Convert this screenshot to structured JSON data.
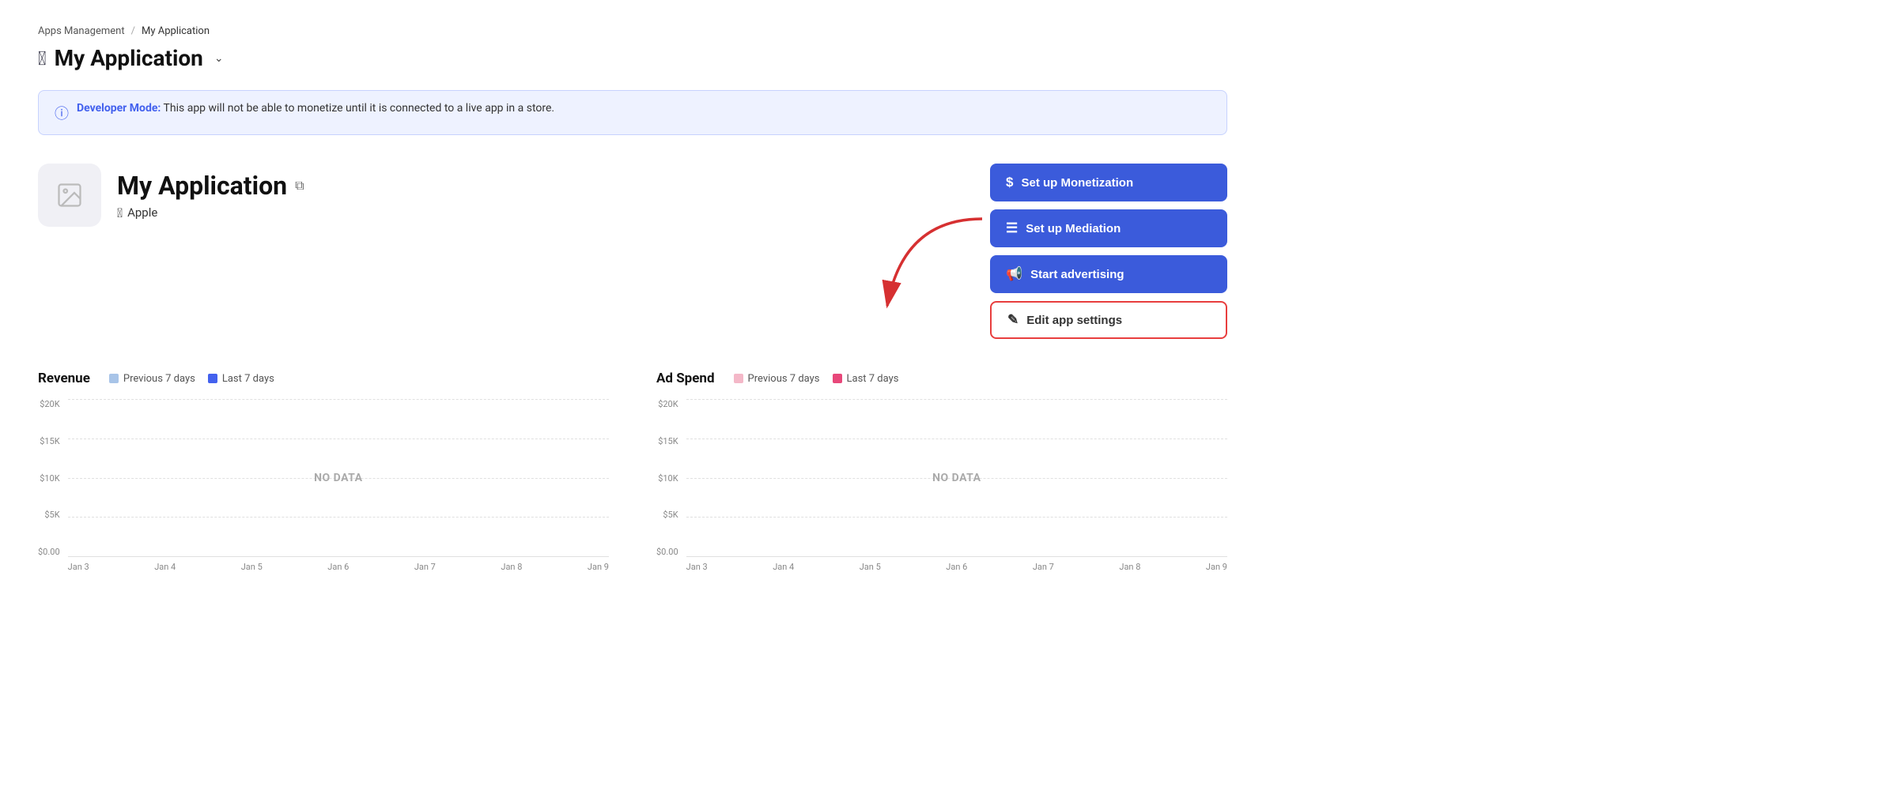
{
  "breadcrumb": {
    "parent": "Apps Management",
    "separator": "/",
    "current": "My Application"
  },
  "page_title": "My Application",
  "dev_banner": {
    "label": "Developer Mode:",
    "message": " This app will not be able to monetize until it is connected to a live app in a store."
  },
  "app": {
    "name": "My Application",
    "platform": "Apple"
  },
  "buttons": {
    "monetization": "Set up Monetization",
    "mediation": "Set up Mediation",
    "advertising": "Start advertising",
    "edit_settings": "Edit app settings"
  },
  "revenue_chart": {
    "title": "Revenue",
    "legend": {
      "prev": "Previous 7 days",
      "last": "Last 7 days"
    },
    "legend_colors": {
      "prev": "#a8c4e8",
      "last": "#4361ee"
    },
    "y_axis": [
      "$20K",
      "$15K",
      "$10K",
      "$5K",
      "$0.00"
    ],
    "x_axis": [
      "Jan 3",
      "Jan 4",
      "Jan 5",
      "Jan 6",
      "Jan 7",
      "Jan 8",
      "Jan 9"
    ],
    "no_data": "NO DATA"
  },
  "ad_spend_chart": {
    "title": "Ad Spend",
    "legend": {
      "prev": "Previous 7 days",
      "last": "Last 7 days"
    },
    "legend_colors": {
      "prev": "#f4b8c8",
      "last": "#e8477a"
    },
    "y_axis": [
      "$20K",
      "$15K",
      "$10K",
      "$5K",
      "$0.00"
    ],
    "x_axis": [
      "Jan 3",
      "Jan 4",
      "Jan 5",
      "Jan 6",
      "Jan 7",
      "Jan 8",
      "Jan 9"
    ],
    "no_data": "NO DATA"
  }
}
